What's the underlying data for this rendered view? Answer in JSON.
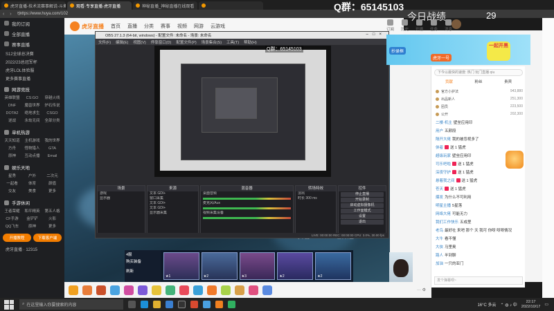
{
  "browser": {
    "tabs": [
      {
        "label": "虎牙直播-技术流赛事解说-斗鱼",
        "active": false
      },
      {
        "label": "观看·专享直播·虎牙直播",
        "active": true
      },
      {
        "label": "神秘直播_神秘直播在线观看",
        "active": false
      },
      {
        "label": "",
        "active": false
      }
    ],
    "url": "https://www.huya.com/102"
  },
  "overlay": {
    "qgroup": "Q群：65145103",
    "today": "今日战绩",
    "count": "29"
  },
  "sidebar": {
    "items": [
      {
        "label": "我的订阅"
      },
      {
        "label": "全部直播"
      },
      {
        "label": "赛事直播"
      }
    ],
    "subitems": [
      "S12全球总决赛",
      "2022/23总冠军杯",
      "虎牙LOL体验服",
      "更多赛事直播"
    ],
    "sections": [
      {
        "title": "网游竞技",
        "grid": [
          "英雄联盟",
          "CS:GO",
          "穿越火线",
          "DNF",
          "魔兽世界",
          "炉石传说",
          "DOTA2",
          "绝地求生",
          "CSGO",
          "逆战",
          "永劫无间",
          "全部分类"
        ]
      },
      {
        "title": "单机热游",
        "grid": [
          "天天知道",
          "主机游戏",
          "我的世界",
          "方舟",
          "怪物猎人",
          "GTA",
          "原神",
          "互动点播",
          "Email"
        ]
      },
      {
        "title": "娱乐天地",
        "grid": [
          "星秀",
          "户外",
          "二次元",
          "一起看",
          "体育",
          "颜值",
          "交友",
          "美食",
          "更多"
        ]
      },
      {
        "title": "手游休闲",
        "grid": [
          "王者荣耀",
          "和平精英",
          "第五人格",
          "CF手游",
          "金铲铲",
          "火影",
          "QQ飞车",
          "原神",
          "更多"
        ]
      }
    ],
    "buttons": [
      "开播教程",
      "下载客户端"
    ],
    "footer": "虎牙直播 · 12315"
  },
  "header": {
    "logo": "虎牙直播",
    "nav": [
      "首页",
      "直播",
      "分类",
      "赛事",
      "视频",
      "网游",
      "云游戏"
    ],
    "right": [
      "订阅",
      "历史",
      "开播",
      "任务",
      "消息"
    ]
  },
  "obs": {
    "title": "OBS 27.1.3 (64-bit, windows) - 配置文件: 未命名 - 场景: 未命名",
    "menu": [
      "文件(F)",
      "编辑(E)",
      "视图(V)",
      "停靠窗口(D)",
      "配置文件(P)",
      "场景集合(S)",
      "工具(T)",
      "帮助(H)"
    ],
    "qgroup": "Q群：65145103",
    "docks": {
      "scenes": {
        "title": "场景",
        "rows": [
          "游戏",
          "显示器"
        ]
      },
      "sources": {
        "title": "来源",
        "rows": [
          "文本 GDI+",
          "窗口采集",
          "文本 GDI+",
          "文本 GDI+",
          "显示器采集"
        ]
      },
      "mixer": {
        "title": "混音器",
        "rows": [
          "桌面音频",
          "麦克风/Aux",
          "视频采集设备"
        ]
      },
      "transitions": {
        "title": "转场特效",
        "rows": [
          "淡出",
          "时长 300 ms"
        ]
      },
      "controls": {
        "title": "控件",
        "buttons": [
          "停止直播",
          "开始录制",
          "启动虚拟摄像机",
          "工作室模式",
          "设置",
          "退出"
        ]
      }
    },
    "status": "LIVE: 00:00:00  REC: 00:00:00  CPU: 3.0%, 30.00 fps"
  },
  "stream": {
    "watermark": "抖音: GoDLike_神超",
    "hud_left": [
      "4服",
      "购买装备",
      "刷新"
    ]
  },
  "banner": {
    "left": "抄录框",
    "mid": "虎牙一号",
    "right": "一起开黑"
  },
  "chat": {
    "search": "下今以最快的速度: 热门 玩门直播 qiu",
    "tabs": [
      "贡献",
      "粉丝",
      "贵宾"
    ],
    "ranks": [
      {
        "name": "官方小护法",
        "value": "943,880"
      },
      {
        "name": "出品新人",
        "value": "251,300"
      },
      {
        "name": "团员",
        "value": "223,500"
      },
      {
        "name": "公开",
        "value": "202,300"
      }
    ],
    "messages": [
      {
        "user": "二楼·机主",
        "text": "壁垒应用印"
      },
      {
        "user": "用户",
        "text": "五颜段"
      },
      {
        "user": "隔开大佬",
        "text": "我的被忽视多了"
      },
      {
        "user": "侠者",
        "text": "送 1 猛虎"
      },
      {
        "user": "超级玩家",
        "text": "壁垒应用印"
      },
      {
        "user": "可乐吧啦",
        "text": "送 1 猛虎"
      },
      {
        "user": "深夜守护",
        "text": "送 1 猛虎"
      },
      {
        "user": "悬着我之间",
        "text": "送 1 猛虎"
      },
      {
        "user": "苍天",
        "text": "送 1 猛虎"
      },
      {
        "user": "爆发",
        "text": "为什么不可利用"
      },
      {
        "user": "明星主播",
        "text": "5星落"
      },
      {
        "user": "网络大佬",
        "text": "可能无力"
      },
      {
        "user": "我们工作快乐",
        "text": "五成里"
      },
      {
        "user": "老鸟",
        "text": "最好社 来吧 那个 天 我可 你呀 呀呀情况"
      },
      {
        "user": "大牛",
        "text": "看不懂"
      },
      {
        "user": "大侠",
        "text": "马里奥"
      },
      {
        "user": "路人",
        "text": "半到聊"
      },
      {
        "user": "加油",
        "text": "一只的亚门"
      }
    ],
    "input": "发个弹幕呗~"
  },
  "taskbar": {
    "search": "在这里输入你要搜索的内容",
    "weather": "16°C 多云",
    "time": "22:17",
    "date": "2022/10/17"
  },
  "colors": {
    "accent": "#f58220",
    "obs_bg": "#2a2a2e"
  }
}
